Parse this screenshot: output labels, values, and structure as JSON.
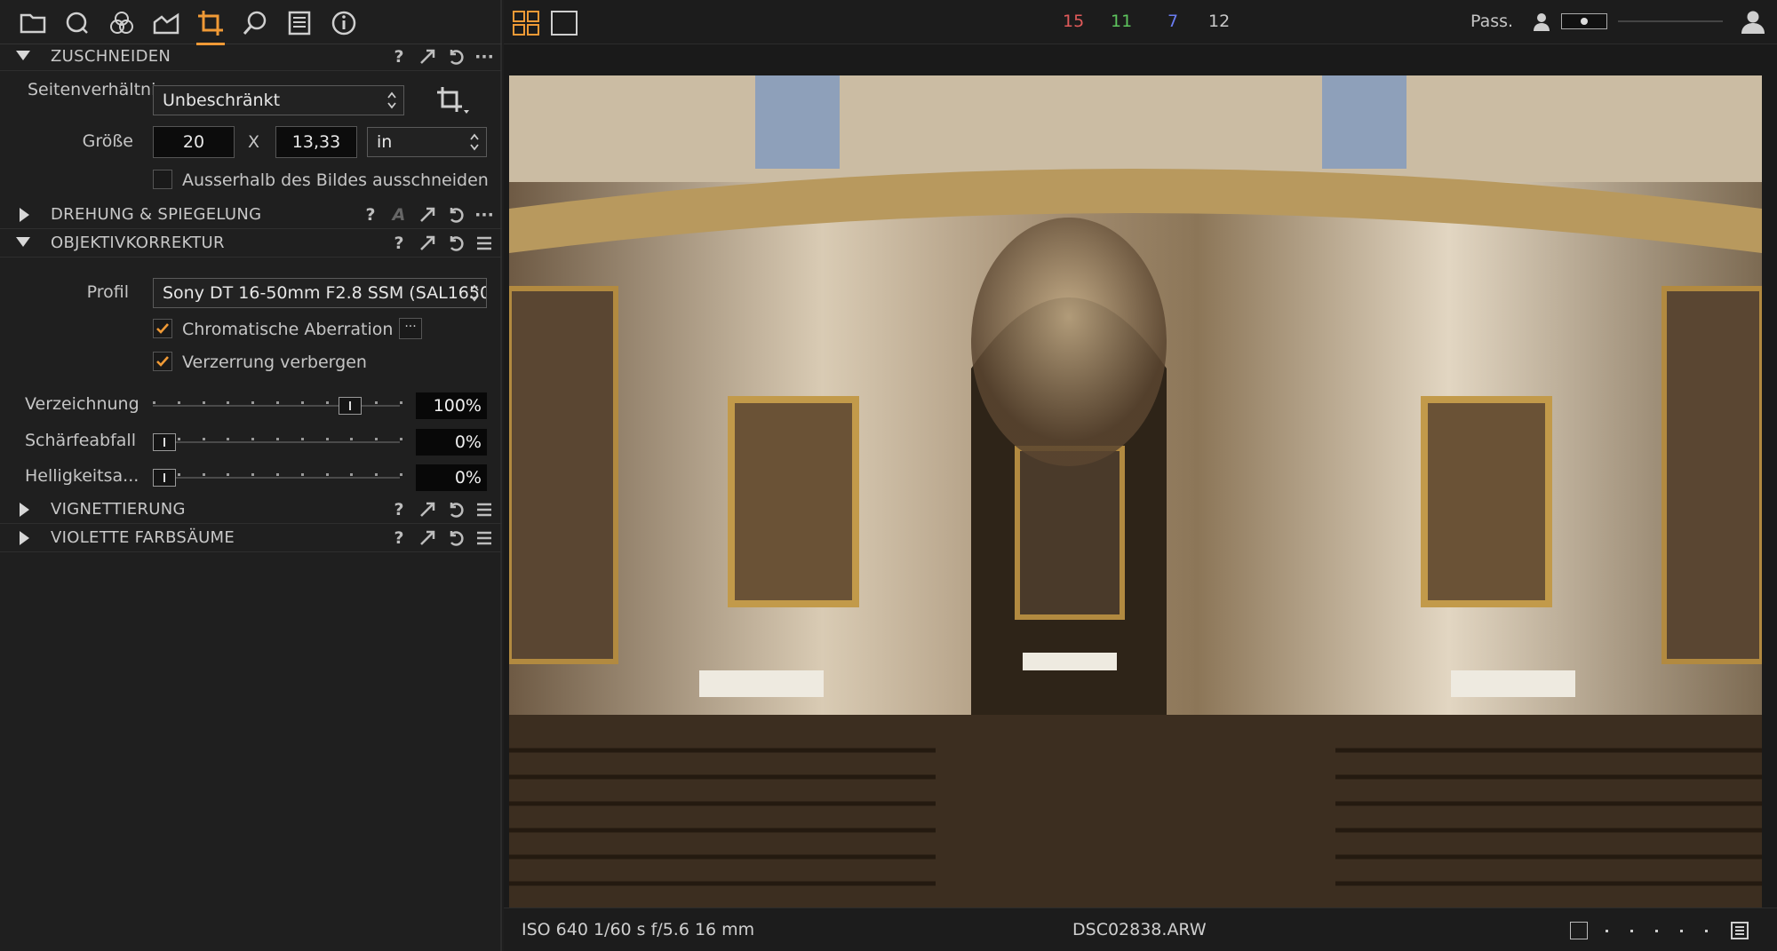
{
  "tool_tabs": [
    {
      "name": "library",
      "icon": "folder-icon"
    },
    {
      "name": "capture",
      "icon": "capture-icon"
    },
    {
      "name": "color",
      "icon": "color-circles-icon"
    },
    {
      "name": "exposure",
      "icon": "exposure-icon"
    },
    {
      "name": "lens-crop",
      "icon": "crop-icon",
      "active": true
    },
    {
      "name": "details",
      "icon": "magnifier-icon"
    },
    {
      "name": "metadata",
      "icon": "list-icon"
    },
    {
      "name": "info",
      "icon": "info-icon"
    }
  ],
  "accent_color": "#f09a36",
  "sections": {
    "crop": {
      "title": "ZUSCHNEIDEN",
      "aspect_label": "Seitenverhältnis",
      "aspect_value": "Unbeschränkt",
      "size_label": "Größe",
      "width": "20",
      "times": "X",
      "height": "13,33",
      "unit": "in",
      "outside_label": "Ausserhalb des Bildes ausschneiden",
      "outside_checked": false
    },
    "rotation": {
      "title": "DREHUNG & SPIEGELUNG"
    },
    "lens": {
      "title": "OBJEKTIVKORREKTUR",
      "profile_label": "Profil",
      "profile_value": "Sony DT 16-50mm F2.8 SSM (SAL1650",
      "chromatic_label": "Chromatische Aberration",
      "chromatic_checked": true,
      "hide_distortion_label": "Verzerrung verbergen",
      "hide_distortion_checked": true,
      "sliders": [
        {
          "label": "Verzeichnung",
          "value": "100%",
          "fraction": 0.83
        },
        {
          "label": "Schärfeabfall",
          "value": "0%",
          "fraction": 0.0
        },
        {
          "label": "Helligkeitsa...",
          "value": "0%",
          "fraction": 0.0
        }
      ]
    },
    "vignetting": {
      "title": "VIGNETTIERUNG"
    },
    "purple_fringing": {
      "title": "VIOLETTE FARBSÄUME"
    }
  },
  "top_bar": {
    "counts": [
      {
        "value": "15",
        "color": "#e05a5a"
      },
      {
        "value": "11",
        "color": "#5ec45e"
      },
      {
        "value": "7",
        "color": "#6a7cf0"
      },
      {
        "value": "12",
        "color": "#c8c8c8"
      }
    ],
    "pass_label": "Pass."
  },
  "status_bar": {
    "exif": "ISO 640  1/60 s  f/5.6  16 mm",
    "filename": "DSC02838.ARW"
  }
}
